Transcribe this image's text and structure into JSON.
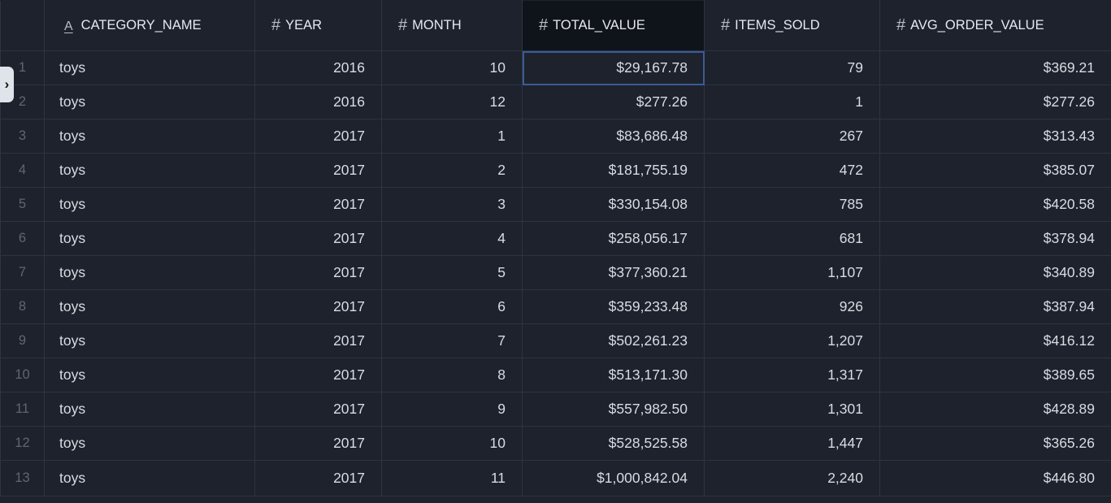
{
  "columns": [
    {
      "name": "CATEGORY_NAME",
      "type_icon": "A"
    },
    {
      "name": "YEAR",
      "type_icon": "#"
    },
    {
      "name": "MONTH",
      "type_icon": "#"
    },
    {
      "name": "TOTAL_VALUE",
      "type_icon": "#"
    },
    {
      "name": "ITEMS_SOLD",
      "type_icon": "#"
    },
    {
      "name": "AVG_ORDER_VALUE",
      "type_icon": "#"
    }
  ],
  "rows": [
    {
      "n": "1",
      "category_name": "toys",
      "year": "2016",
      "month": "10",
      "total_value": "$29,167.78",
      "items_sold": "79",
      "avg_order_value": "$369.21"
    },
    {
      "n": "2",
      "category_name": "toys",
      "year": "2016",
      "month": "12",
      "total_value": "$277.26",
      "items_sold": "1",
      "avg_order_value": "$277.26"
    },
    {
      "n": "3",
      "category_name": "toys",
      "year": "2017",
      "month": "1",
      "total_value": "$83,686.48",
      "items_sold": "267",
      "avg_order_value": "$313.43"
    },
    {
      "n": "4",
      "category_name": "toys",
      "year": "2017",
      "month": "2",
      "total_value": "$181,755.19",
      "items_sold": "472",
      "avg_order_value": "$385.07"
    },
    {
      "n": "5",
      "category_name": "toys",
      "year": "2017",
      "month": "3",
      "total_value": "$330,154.08",
      "items_sold": "785",
      "avg_order_value": "$420.58"
    },
    {
      "n": "6",
      "category_name": "toys",
      "year": "2017",
      "month": "4",
      "total_value": "$258,056.17",
      "items_sold": "681",
      "avg_order_value": "$378.94"
    },
    {
      "n": "7",
      "category_name": "toys",
      "year": "2017",
      "month": "5",
      "total_value": "$377,360.21",
      "items_sold": "1,107",
      "avg_order_value": "$340.89"
    },
    {
      "n": "8",
      "category_name": "toys",
      "year": "2017",
      "month": "6",
      "total_value": "$359,233.48",
      "items_sold": "926",
      "avg_order_value": "$387.94"
    },
    {
      "n": "9",
      "category_name": "toys",
      "year": "2017",
      "month": "7",
      "total_value": "$502,261.23",
      "items_sold": "1,207",
      "avg_order_value": "$416.12"
    },
    {
      "n": "10",
      "category_name": "toys",
      "year": "2017",
      "month": "8",
      "total_value": "$513,171.30",
      "items_sold": "1,317",
      "avg_order_value": "$389.65"
    },
    {
      "n": "11",
      "category_name": "toys",
      "year": "2017",
      "month": "9",
      "total_value": "$557,982.50",
      "items_sold": "1,301",
      "avg_order_value": "$428.89"
    },
    {
      "n": "12",
      "category_name": "toys",
      "year": "2017",
      "month": "10",
      "total_value": "$528,525.58",
      "items_sold": "1,447",
      "avg_order_value": "$365.26"
    },
    {
      "n": "13",
      "category_name": "toys",
      "year": "2017",
      "month": "11",
      "total_value": "$1,000,842.04",
      "items_sold": "2,240",
      "avg_order_value": "$446.80"
    }
  ],
  "selected_cell": {
    "row": 0,
    "column": "total_value"
  },
  "sorted_column": "TOTAL_VALUE",
  "icons": {
    "expand": "chevron-right-icon",
    "text_type": "text-type-icon",
    "number_type": "number-type-icon"
  },
  "colors": {
    "background": "#1d222c",
    "header_active": "#0f131a",
    "selection": "#3a5c98",
    "border": "#2e3440",
    "row_number": "#5f6674"
  }
}
